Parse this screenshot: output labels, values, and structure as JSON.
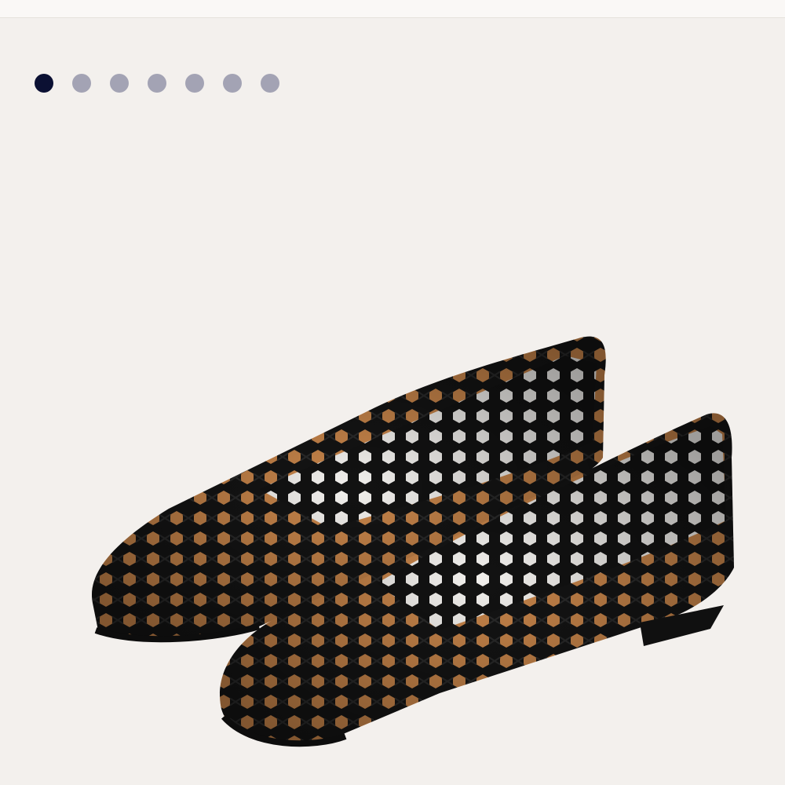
{
  "gallery": {
    "image_count": 7,
    "active_index": 0,
    "image_description_icon": "woven-leather-flats-image",
    "colors": {
      "background": "#f3f0ed",
      "dot_active": "#0b1033",
      "dot_inactive": "#a3a3b4",
      "shoe_leather": "#151515",
      "shoe_lining": "#c8854a"
    }
  }
}
